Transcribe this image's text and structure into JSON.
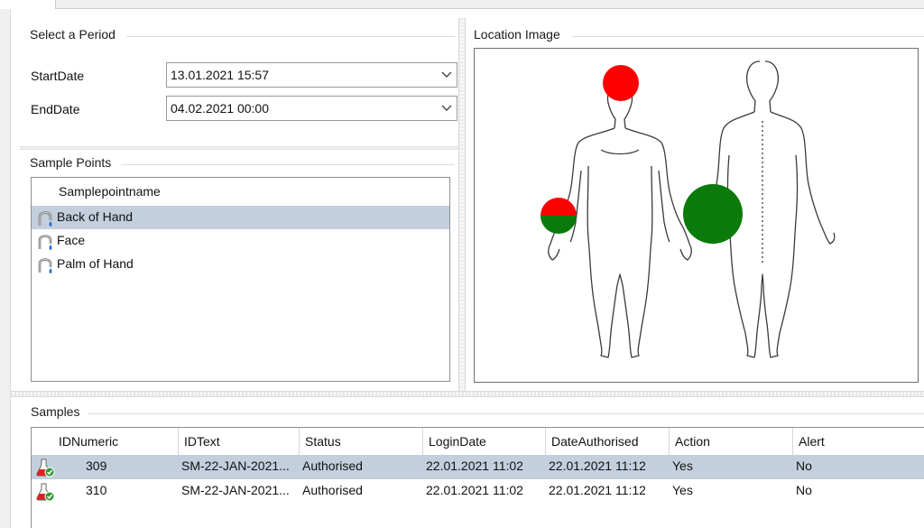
{
  "period": {
    "title": "Select a Period",
    "start_label": "StartDate",
    "start_value": "13.01.2021 15:57",
    "end_label": "EndDate",
    "end_value": "04.02.2021 00:00"
  },
  "sample_points": {
    "title": "Sample Points",
    "column": "Samplepointname",
    "items": [
      {
        "label": "Back of Hand",
        "selected": true,
        "icon": "sample-point-icon"
      },
      {
        "label": "Face",
        "selected": false,
        "icon": "sample-point-icon"
      },
      {
        "label": "Palm of Hand",
        "selected": false,
        "icon": "sample-point-icon"
      }
    ]
  },
  "location_image": {
    "title": "Location Image",
    "markers": [
      {
        "name": "face-marker",
        "colors": [
          "#ff0000"
        ]
      },
      {
        "name": "back-of-hand-marker",
        "colors": [
          "#ff0000",
          "#0a7a0a"
        ]
      },
      {
        "name": "palm-of-hand-marker",
        "colors": [
          "#0a7a0a"
        ]
      }
    ]
  },
  "samples": {
    "title": "Samples",
    "columns": [
      "IDNumeric",
      "IDText",
      "Status",
      "LoginDate",
      "DateAuthorised",
      "Action",
      "Alert"
    ],
    "rows": [
      {
        "selected": true,
        "icon": "flask-check-icon",
        "cells": [
          "309",
          "SM-22-JAN-2021...",
          "Authorised",
          "22.01.2021 11:02",
          "22.01.2021 11:12",
          "Yes",
          "No"
        ]
      },
      {
        "selected": false,
        "icon": "flask-check-icon",
        "cells": [
          "310",
          "SM-22-JAN-2021...",
          "Authorised",
          "22.01.2021 11:02",
          "22.01.2021 11:12",
          "Yes",
          "No"
        ]
      }
    ]
  },
  "colors": {
    "selection": "#c3cfdd",
    "marker_red": "#ff0000",
    "marker_green": "#0a7a0a"
  }
}
